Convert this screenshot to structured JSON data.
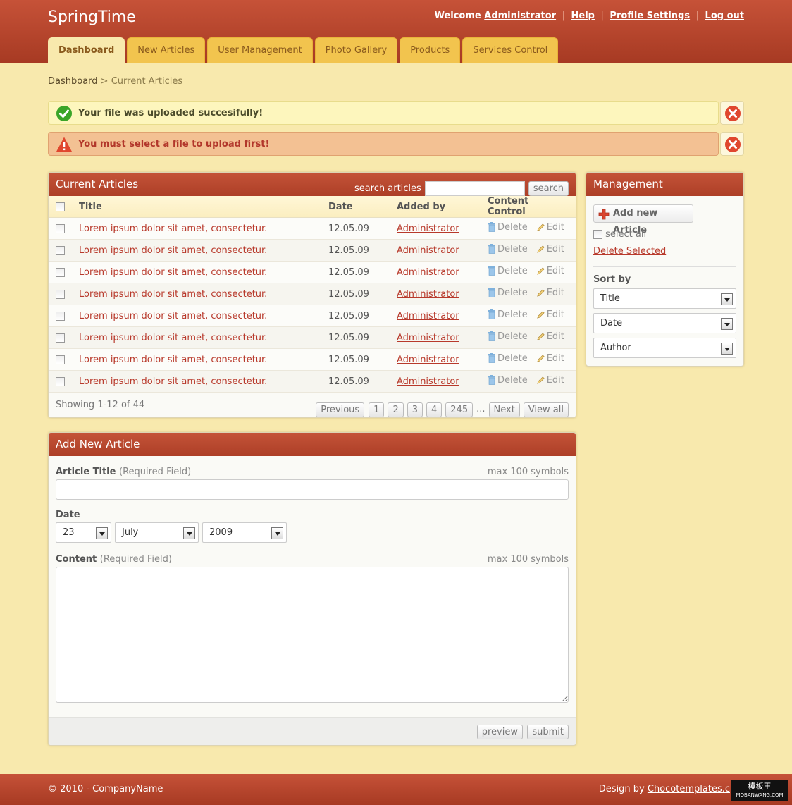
{
  "header": {
    "logo": "SpringTime",
    "welcome_text": "Welcome",
    "user": "Administrator",
    "links": [
      "Help",
      "Profile Settings",
      "Log out"
    ]
  },
  "nav": {
    "tabs": [
      "Dashboard",
      "New Articles",
      "User Management",
      "Photo Gallery",
      "Products",
      "Services Control"
    ],
    "active": "Dashboard"
  },
  "breadcrumb": {
    "root": "Dashboard",
    "separator": ">",
    "current": "Current Articles"
  },
  "alerts": {
    "success": "Your file was uploaded succesifully!",
    "error": "You must select a file to upload first!"
  },
  "articles": {
    "title": "Current Articles",
    "search_label": "search articles",
    "search_placeholder": "",
    "search_button": "search",
    "columns": [
      "Title",
      "Date",
      "Added by",
      "Content Control"
    ],
    "rows": [
      {
        "title": "Lorem ipsum dolor sit amet, consectetur.",
        "date": "12.05.09",
        "author": "Administrator"
      },
      {
        "title": "Lorem ipsum dolor sit amet, consectetur.",
        "date": "12.05.09",
        "author": "Administrator"
      },
      {
        "title": "Lorem ipsum dolor sit amet, consectetur.",
        "date": "12.05.09",
        "author": "Administrator"
      },
      {
        "title": "Lorem ipsum dolor sit amet, consectetur.",
        "date": "12.05.09",
        "author": "Administrator"
      },
      {
        "title": "Lorem ipsum dolor sit amet, consectetur.",
        "date": "12.05.09",
        "author": "Administrator"
      },
      {
        "title": "Lorem ipsum dolor sit amet, consectetur.",
        "date": "12.05.09",
        "author": "Administrator"
      },
      {
        "title": "Lorem ipsum dolor sit amet, consectetur.",
        "date": "12.05.09",
        "author": "Administrator"
      },
      {
        "title": "Lorem ipsum dolor sit amet, consectetur.",
        "date": "12.05.09",
        "author": "Administrator"
      }
    ],
    "delete_label": "Delete",
    "edit_label": "Edit",
    "showing": "Showing 1-12 of 44",
    "pager": {
      "previous": "Previous",
      "pages": [
        "1",
        "2",
        "3",
        "4",
        "245"
      ],
      "ellipsis": "...",
      "next": "Next",
      "view_all": "View all"
    }
  },
  "management": {
    "title": "Management",
    "add_button": "Add new Article",
    "select_all": "select all",
    "delete_selected": "Delete Selected",
    "sort_by_label": "Sort by",
    "sort_options": [
      "Title",
      "Date",
      "Author"
    ]
  },
  "add_article": {
    "title": "Add New Article",
    "article_title_label": "Article Title",
    "required_note": "(Required Field)",
    "max_note": "max 100 symbols",
    "date_label": "Date",
    "day": "23",
    "month": "July",
    "year": "2009",
    "content_label": "Content",
    "preview_button": "preview",
    "submit_button": "submit"
  },
  "footer": {
    "copyright": "© 2010 - CompanyName",
    "design_by": "Design by",
    "design_link": "Chocotemplates.c"
  },
  "watermark": {
    "line1": "模板王",
    "line2": "MOBANWANG.COM"
  },
  "colors": {
    "header_red": "#b8452c",
    "tab_yellow": "#f2c44e",
    "page_bg": "#f8e9ad",
    "link_red": "#b8392b",
    "success_green": "#3aa528",
    "error_red": "#e0472e"
  }
}
